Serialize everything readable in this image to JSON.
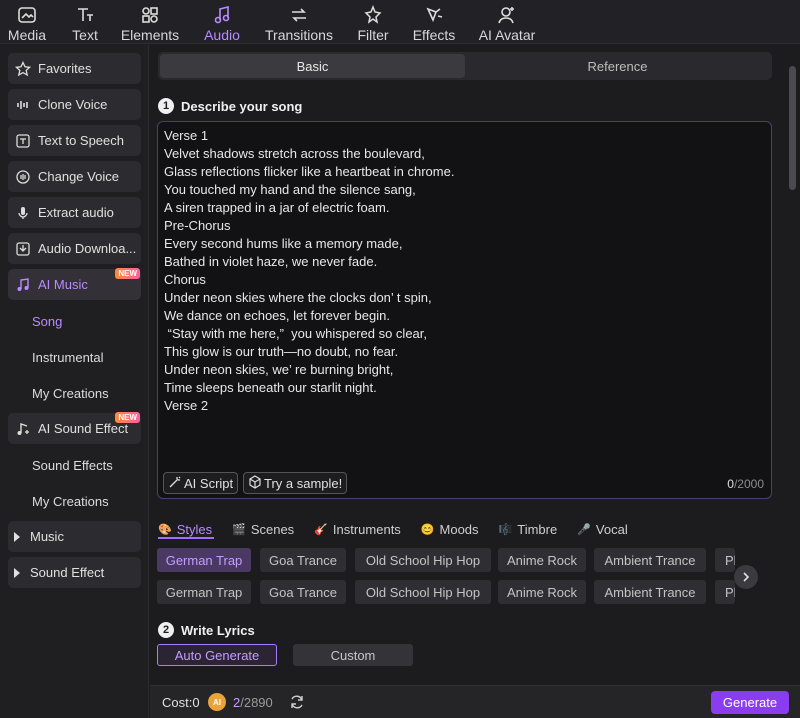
{
  "toolbar": {
    "items": [
      {
        "label": "Media",
        "icon": "media-icon"
      },
      {
        "label": "Text",
        "icon": "text-icon"
      },
      {
        "label": "Elements",
        "icon": "elements-icon"
      },
      {
        "label": "Audio",
        "icon": "audio-icon",
        "active": true
      },
      {
        "label": "Transitions",
        "icon": "transitions-icon"
      },
      {
        "label": "Filter",
        "icon": "filter-icon"
      },
      {
        "label": "Effects",
        "icon": "effects-icon"
      },
      {
        "label": "AI Avatar",
        "icon": "ai-avatar-icon"
      }
    ]
  },
  "sidebar": {
    "items": [
      {
        "label": "Favorites",
        "icon": "star-icon"
      },
      {
        "label": "Clone Voice",
        "icon": "waveform-icon"
      },
      {
        "label": "Text to Speech",
        "icon": "text-to-speech-icon"
      },
      {
        "label": "Change Voice",
        "icon": "change-voice-icon"
      },
      {
        "label": "Extract audio",
        "icon": "microphone-icon"
      },
      {
        "label": "Audio Downloa...",
        "icon": "download-icon"
      },
      {
        "label": "AI Music",
        "icon": "music-note-icon",
        "badge": "NEW"
      },
      {
        "label": "AI Sound Effect",
        "icon": "sound-effect-icon",
        "badge": "NEW"
      },
      {
        "label": "Music",
        "icon": "chevron-right-icon"
      },
      {
        "label": "Sound Effect",
        "icon": "chevron-right-icon"
      }
    ],
    "ai_music_sub": [
      "Song",
      "Instrumental",
      "My Creations"
    ],
    "ai_sound_sub": [
      "Sound Effects",
      "My Creations"
    ]
  },
  "tabs": [
    "Basic",
    "Reference"
  ],
  "describe": {
    "step": "1",
    "title": "Describe your song",
    "lyrics": "Verse 1\nVelvet shadows stretch across the boulevard,\nGlass reflections flicker like a heartbeat in chrome.\nYou touched my hand and the silence sang,\nA siren trapped in a jar of electric foam.\nPre-Chorus\nEvery second hums like a memory made,\nBathed in violet haze, we never fade.\nChorus\nUnder neon skies where the clocks don’ t spin,\nWe dance on echoes, let forever begin.\n “Stay with me here,”  you whispered so clear,\nThis glow is our truth—no doubt, no fear.\nUnder neon skies, we’ re burning bright,\nTime sleeps beneath our starlit night.\nVerse 2",
    "ai_script_label": "AI Script",
    "sample_label": "Try a sample!",
    "count": "0",
    "max": "/2000"
  },
  "categories": [
    "Styles",
    "Scenes",
    "Instruments",
    "Moods",
    "Timbre",
    "Vocal"
  ],
  "chips_row1": [
    "German Trap",
    "Goa Trance",
    "Old School Hip Hop",
    "Anime Rock",
    "Ambient Trance",
    "Pl"
  ],
  "chips_row2": [
    "German Trap",
    "Goa Trance",
    "Old School Hip Hop",
    "Anime Rock",
    "Ambient Trance",
    "Pl"
  ],
  "lyrics_section": {
    "step": "2",
    "title": "Write Lyrics",
    "auto_label": "Auto Generate",
    "custom_label": "Custom"
  },
  "footer": {
    "cost": "Cost:0",
    "credit_icon_text": "AI",
    "credits_used": "2",
    "credits_total": "/2890",
    "generate_label": "Generate"
  },
  "colors": {
    "accent": "#8a3df0",
    "accent_text": "#b98bff"
  }
}
